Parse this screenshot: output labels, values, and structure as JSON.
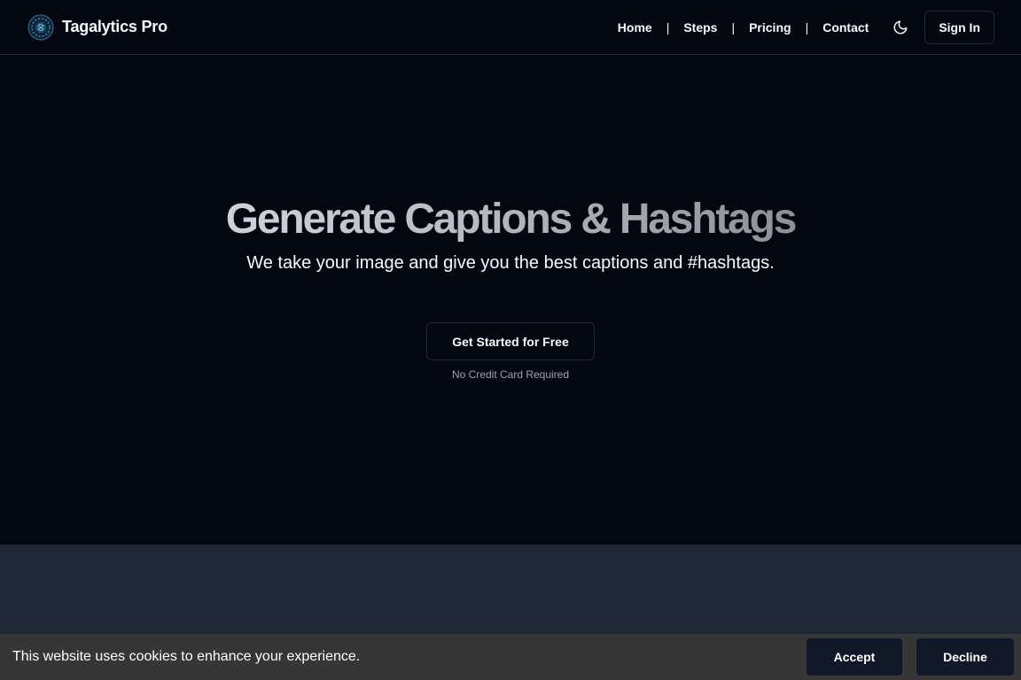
{
  "header": {
    "brand_name": "Tagalytics Pro",
    "logo_icon": "brain-globe-logo",
    "nav": [
      {
        "label": "Home"
      },
      {
        "label": "Steps"
      },
      {
        "label": "Pricing"
      },
      {
        "label": "Contact"
      }
    ],
    "separator": "|",
    "theme_icon": "moon-icon",
    "sign_in_label": "Sign In"
  },
  "hero": {
    "title": "Generate Captions & Hashtags",
    "subtitle": "We take your image and give you the best captions and #hashtags.",
    "cta_label": "Get Started for Free",
    "cta_note": "No Credit Card Required"
  },
  "cookie_banner": {
    "message": "This website uses cookies to enhance your experience.",
    "accept_label": "Accept",
    "decline_label": "Decline"
  },
  "colors": {
    "background": "#030712",
    "lower_section": "#1e2735",
    "banner": "#363636",
    "button_dark": "#111827",
    "border": "#1f2937"
  }
}
